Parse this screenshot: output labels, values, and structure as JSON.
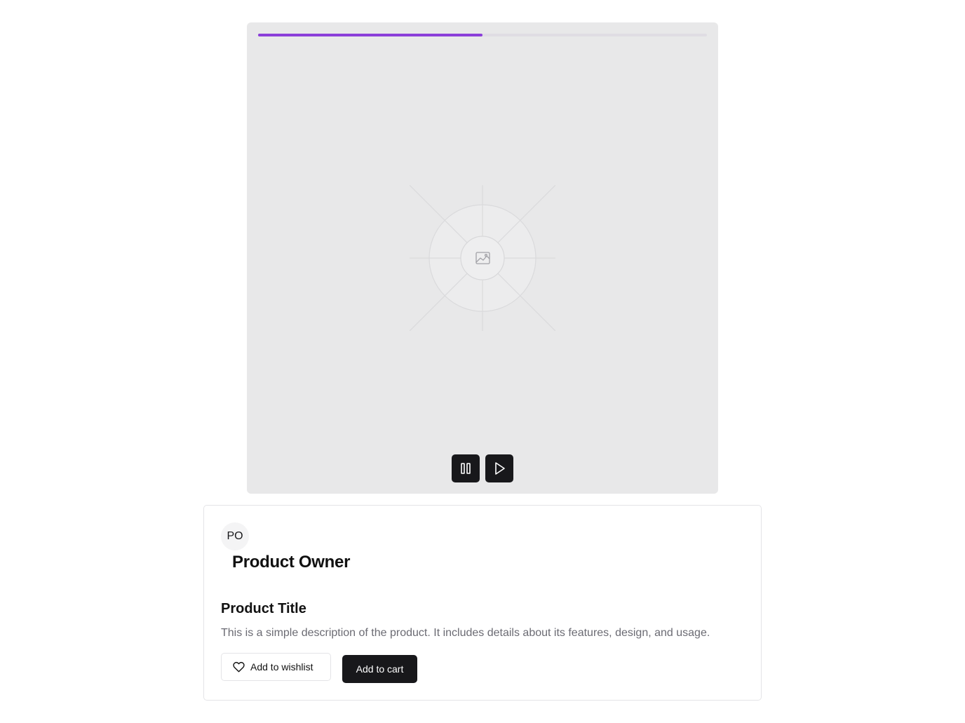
{
  "media": {
    "progress_percent": 50,
    "progress_color": "#8b3fd9",
    "placeholder_icon": "image-icon",
    "controls": {
      "pause_icon": "pause-icon",
      "play_icon": "play-icon"
    }
  },
  "card": {
    "owner_initials": "PO",
    "owner_name": "Product Owner",
    "product_title": "Product Title",
    "product_description": "This is a simple description of the product. It includes details about its features, design, and usage.",
    "wishlist_label": "Add to wishlist",
    "wishlist_icon": "heart-icon",
    "cart_label": "Add to cart"
  }
}
